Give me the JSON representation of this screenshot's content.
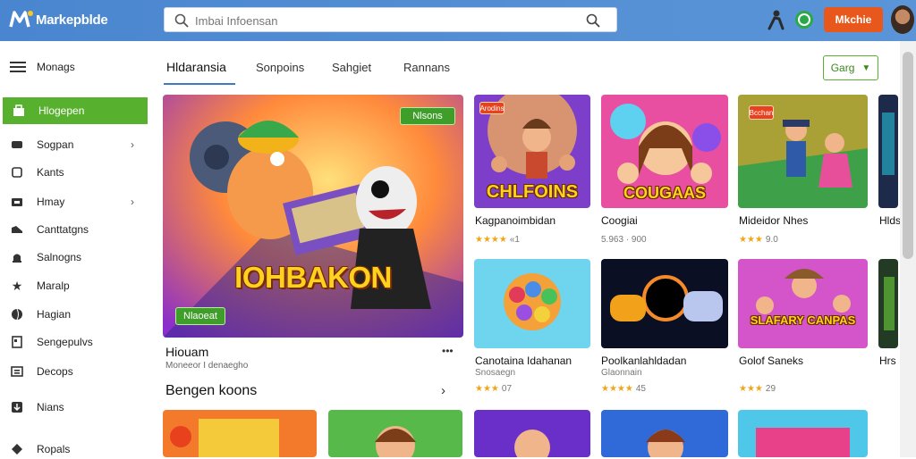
{
  "app": {
    "logo_text": "Markepblde",
    "search_placeholder": "Imbai Infoensan",
    "cta_label": "Mkchie"
  },
  "sidebar": {
    "menu_label": "Monags",
    "items": [
      {
        "label": "Hlogepen",
        "icon": "store-icon",
        "active": true
      },
      {
        "label": "Sogpan",
        "icon": "controller-icon",
        "chevron": true
      },
      {
        "label": "Kants",
        "icon": "gift-icon"
      },
      {
        "label": "Hmay",
        "icon": "gamepad-icon",
        "chevron": true
      },
      {
        "label": "Canttatgns",
        "icon": "shoe-icon"
      },
      {
        "label": "Salnogns",
        "icon": "bell-icon"
      },
      {
        "label": "Maralp",
        "icon": "star-icon"
      },
      {
        "label": "Hagian",
        "icon": "globe-icon"
      },
      {
        "label": "Sengepulvs",
        "icon": "grid-icon"
      },
      {
        "label": "Decops",
        "icon": "list-icon"
      },
      {
        "label": "Nians",
        "icon": "download-icon"
      },
      {
        "label": "Ropals",
        "icon": "tag-icon"
      }
    ]
  },
  "tabs": [
    {
      "label": "Hldaransia",
      "active": true
    },
    {
      "label": "Sonpoins"
    },
    {
      "label": "Sahgiet"
    },
    {
      "label": "Rannans"
    }
  ],
  "sort_label": "Garg",
  "hero": {
    "badge": "Nlsons",
    "art_title": "IOHBAKON",
    "cta": "Nlaoeat",
    "caption": "Hiouam",
    "sub": "Moneeor I denaegho"
  },
  "section_title": "Bengen koons",
  "cards_row1": [
    {
      "title": "Kagpanoimbidan",
      "rating": "★★★★",
      "rating_num": "«1",
      "art": "CHLFOINS",
      "badge": "Arodins",
      "theme": "adventure"
    },
    {
      "title": "Coogiai",
      "sub": "5.963 · 900",
      "art": "COUGAAS",
      "badge": "",
      "theme": "girl"
    },
    {
      "title": "Mideidor Nhes",
      "rating": "★★★",
      "rating_num": "9.0",
      "art": "",
      "badge": "Bcchan",
      "theme": "village"
    }
  ],
  "cards_row2": [
    {
      "title": "Canotaina Idahanan",
      "sub": "Snosaegn",
      "rating": "★★★",
      "rating_num": "07",
      "art": "",
      "theme": "puzzle"
    },
    {
      "title": "Poolkanlahldadan",
      "sub": "Glaonnain",
      "rating": "★★★★",
      "rating_num": "45",
      "art": "",
      "theme": "space"
    },
    {
      "title": "Golof Saneks",
      "sub": "",
      "rating": "★★★",
      "rating_num": "29",
      "art": "SLAFARY CANPAS",
      "theme": "safari"
    }
  ],
  "cards_edge": [
    {
      "title": "Hlds"
    },
    {
      "title": "Hrs"
    }
  ],
  "colors": {
    "topbar": "#4a86cf",
    "accent_green": "#58b12e",
    "cta_orange": "#e8581c",
    "tab_underline": "#3f7ac4",
    "star": "#f2a516"
  }
}
